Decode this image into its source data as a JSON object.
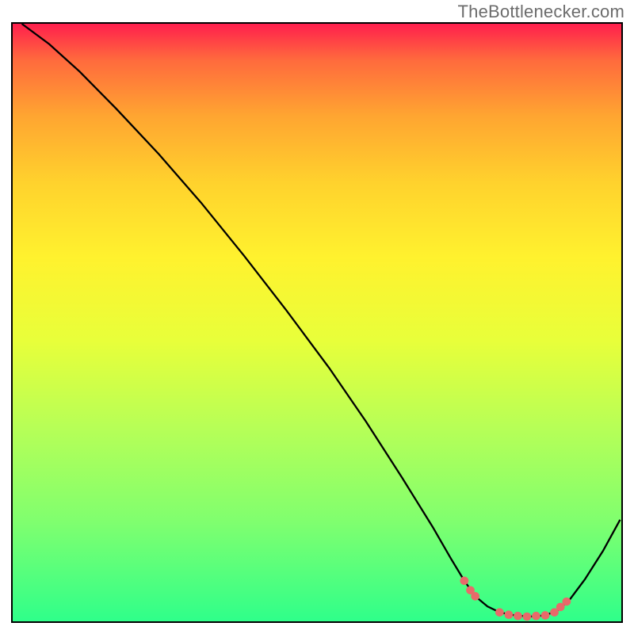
{
  "watermark": "TheBottlenecker.com",
  "chart_data": {
    "type": "line",
    "title": "",
    "xlabel": "",
    "ylabel": "",
    "x_normalized_range": [
      0,
      1
    ],
    "y_normalized_range": [
      0,
      1
    ],
    "gradient_colors_top_to_bottom": [
      "#ff1f4d",
      "#ff6a3d",
      "#ffa531",
      "#ffd22d",
      "#fff22e",
      "#e8ff3a",
      "#b6ff57",
      "#7fff6f",
      "#2fff8a"
    ],
    "curve_points_xy": [
      [
        0.015,
        1.0
      ],
      [
        0.06,
        0.966
      ],
      [
        0.11,
        0.92
      ],
      [
        0.17,
        0.858
      ],
      [
        0.24,
        0.782
      ],
      [
        0.31,
        0.7
      ],
      [
        0.38,
        0.612
      ],
      [
        0.45,
        0.52
      ],
      [
        0.52,
        0.424
      ],
      [
        0.58,
        0.335
      ],
      [
        0.64,
        0.24
      ],
      [
        0.69,
        0.158
      ],
      [
        0.72,
        0.105
      ],
      [
        0.742,
        0.068
      ],
      [
        0.76,
        0.042
      ],
      [
        0.78,
        0.025
      ],
      [
        0.8,
        0.015
      ],
      [
        0.825,
        0.01
      ],
      [
        0.85,
        0.008
      ],
      [
        0.875,
        0.01
      ],
      [
        0.895,
        0.018
      ],
      [
        0.915,
        0.036
      ],
      [
        0.94,
        0.07
      ],
      [
        0.97,
        0.118
      ],
      [
        0.998,
        0.17
      ]
    ],
    "dot_markers_xy": [
      [
        0.742,
        0.068
      ],
      [
        0.752,
        0.052
      ],
      [
        0.76,
        0.042
      ],
      [
        0.8,
        0.015
      ],
      [
        0.815,
        0.011
      ],
      [
        0.83,
        0.009
      ],
      [
        0.845,
        0.008
      ],
      [
        0.86,
        0.009
      ],
      [
        0.875,
        0.01
      ],
      [
        0.89,
        0.015
      ],
      [
        0.9,
        0.024
      ],
      [
        0.91,
        0.033
      ]
    ],
    "marker_color": "#e86a6a",
    "line_color": "#000000"
  }
}
